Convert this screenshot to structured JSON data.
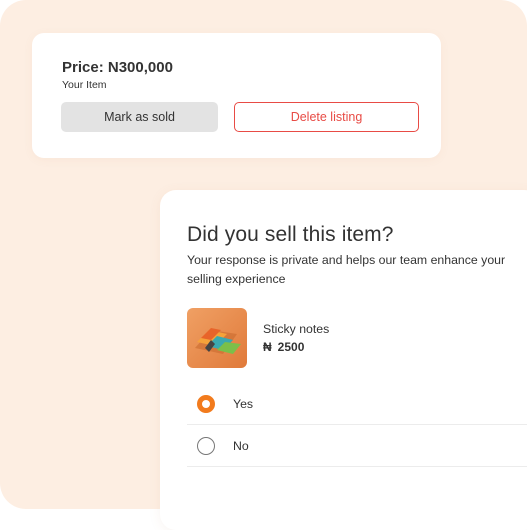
{
  "listing": {
    "price": "Price: N300,000",
    "subtitle": "Your Item",
    "mark_sold_label": "Mark as sold",
    "delete_label": "Delete listing"
  },
  "survey": {
    "title": "Did you sell this item?",
    "description": "Your response is private and helps our team enhance your selling experience",
    "product": {
      "name": "Sticky notes",
      "currency_symbol": "₦",
      "price": "2500"
    },
    "options": [
      {
        "label": "Yes",
        "selected": true
      },
      {
        "label": "No",
        "selected": false
      }
    ]
  },
  "colors": {
    "background_panel": "#fdeee2",
    "accent_orange": "#f27b1d",
    "delete_red": "#e84b45"
  }
}
